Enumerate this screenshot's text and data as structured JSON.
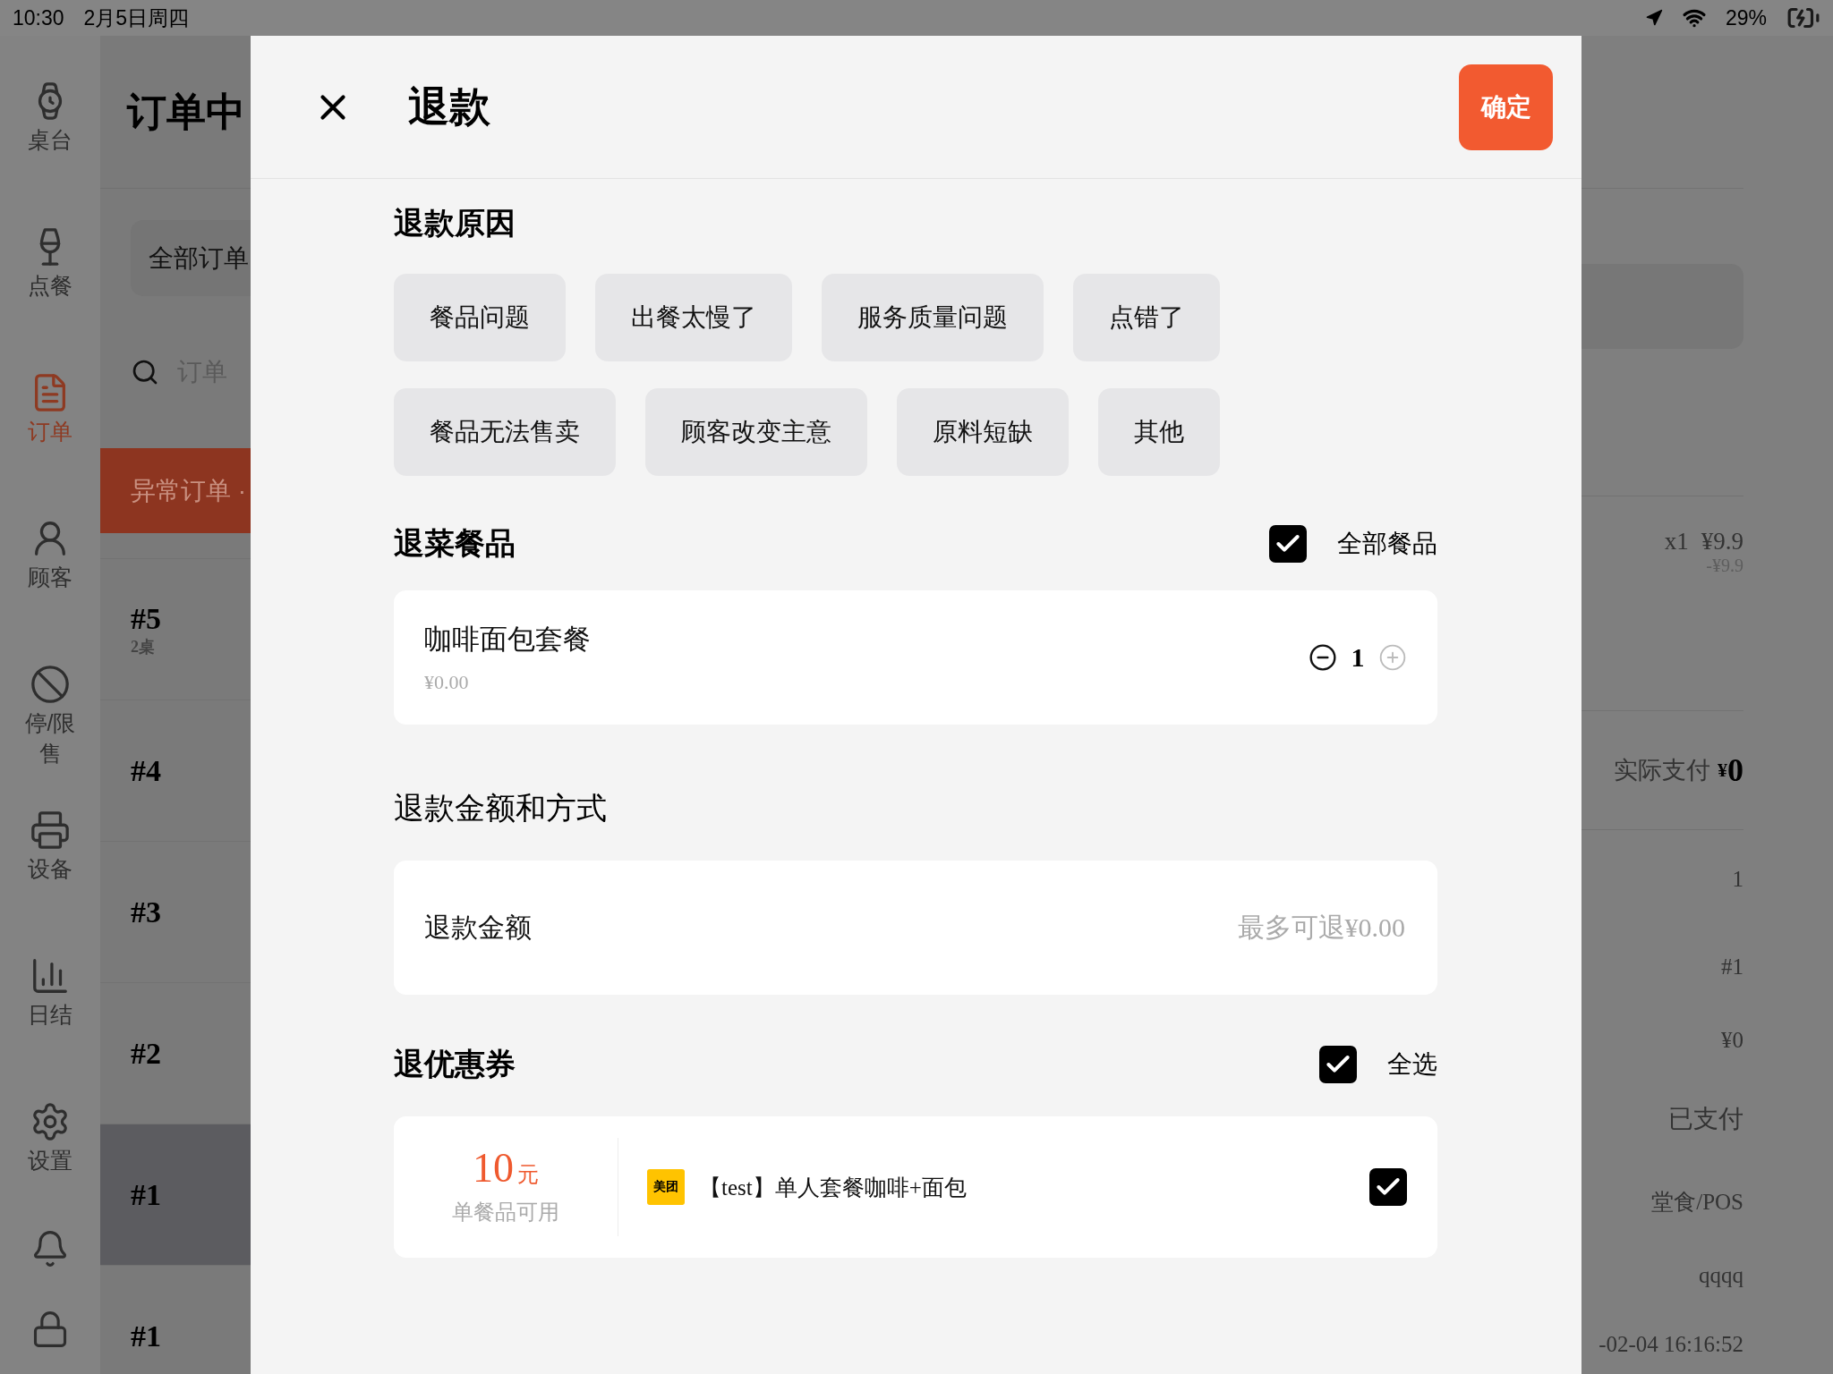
{
  "status_bar": {
    "time": "10:30",
    "date": "2月5日周四",
    "battery": "29%"
  },
  "sidebar": {
    "items": [
      {
        "label": "桌台",
        "selected": false
      },
      {
        "label": "点餐",
        "selected": false
      },
      {
        "label": "订单",
        "selected": true
      },
      {
        "label": "顾客",
        "selected": false
      },
      {
        "label": "停/限售",
        "selected": false
      },
      {
        "label": "设备",
        "selected": false
      },
      {
        "label": "日结",
        "selected": false
      },
      {
        "label": "设置",
        "selected": false
      }
    ]
  },
  "order_list": {
    "title": "订单中",
    "tab": "全部订单",
    "search_placeholder": "订单",
    "alert": "异常订单 ·",
    "rows": [
      {
        "number": "#5",
        "table": "2桌",
        "selected": false
      },
      {
        "number": "#4",
        "selected": false
      },
      {
        "number": "#3",
        "selected": false
      },
      {
        "number": "#2",
        "selected": false
      },
      {
        "number": "#1",
        "selected": true
      },
      {
        "number": "#1",
        "selected": false
      }
    ]
  },
  "detail": {
    "quantity": "x1",
    "price": "¥9.9",
    "discount": "-¥9.9",
    "paid_label": "实际支付",
    "paid_currency": "¥",
    "paid_amount": "0",
    "fields": [
      "1",
      "#1",
      "¥0",
      "已支付",
      "堂食/POS",
      "qqqq",
      "-02-04 16:16:52"
    ]
  },
  "dialog": {
    "title": "退款",
    "confirm": "确定",
    "reason_section": {
      "title": "退款原因",
      "rows": [
        [
          {
            "label": "餐品问题",
            "selected": false
          },
          {
            "label": "出餐太慢了",
            "selected": false
          },
          {
            "label": "服务质量问题",
            "selected": false
          },
          {
            "label": "点错了",
            "selected": false
          }
        ],
        [
          {
            "label": "餐品无法售卖",
            "selected": false
          },
          {
            "label": "顾客改变主意",
            "selected": false
          },
          {
            "label": "原料短缺",
            "selected": false
          },
          {
            "label": "其他",
            "selected": false
          }
        ]
      ]
    },
    "items_section": {
      "title": "退菜餐品",
      "select_all": {
        "label": "全部餐品",
        "checked": true
      },
      "items": [
        {
          "name": "咖啡面包套餐",
          "price": "¥0.00",
          "quantity": "1",
          "increase_disabled": true
        }
      ]
    },
    "amount_section": {
      "title": "退款金额和方式",
      "label": "退款金额",
      "placeholder": "最多可退¥0.00"
    },
    "coupon_section": {
      "title": "退优惠券",
      "select_all": {
        "label": "全选",
        "checked": true
      },
      "coupons": [
        {
          "value": "10",
          "unit": "元",
          "scope": "单餐品可用",
          "source": "美团",
          "name": "【test】单人套餐咖啡+面包",
          "checked": true
        }
      ]
    }
  }
}
